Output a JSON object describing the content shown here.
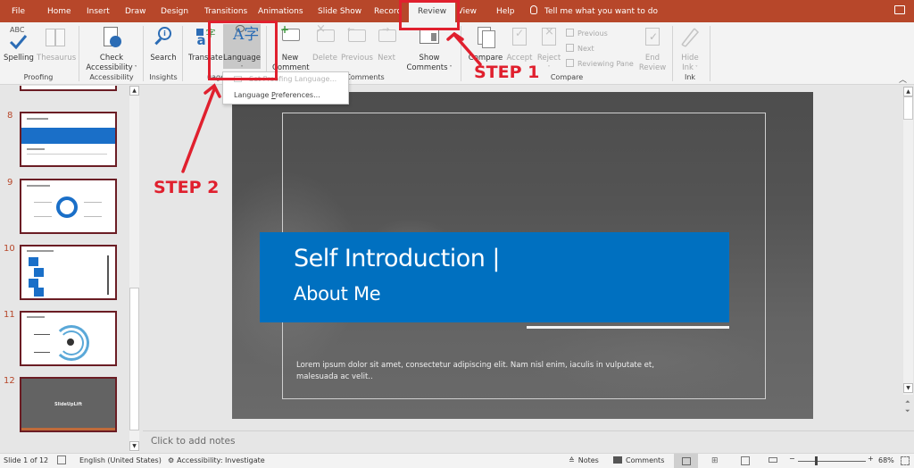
{
  "tabs": [
    {
      "label": "File"
    },
    {
      "label": "Home"
    },
    {
      "label": "Insert"
    },
    {
      "label": "Draw"
    },
    {
      "label": "Design"
    },
    {
      "label": "Transitions"
    },
    {
      "label": "Animations"
    },
    {
      "label": "Slide Show"
    },
    {
      "label": "Record"
    },
    {
      "label": "Review",
      "active": true
    },
    {
      "label": "View"
    },
    {
      "label": "Help"
    }
  ],
  "tell_me": "Tell me what you want to do",
  "ribbon": {
    "proofing": {
      "label": "Proofing",
      "spelling": "Spelling",
      "thesaurus": "Thesaurus",
      "spelling_icon_text": "ABC"
    },
    "accessibility": {
      "label": "Accessibility",
      "check_line1": "Check",
      "check_line2": "Accessibility"
    },
    "insights": {
      "label": "Insights",
      "search": "Search"
    },
    "language": {
      "label": "Language",
      "translate": "Translate",
      "language": "Language",
      "icon_glyph": "A字"
    },
    "comments": {
      "label": "Comments",
      "new_line1": "New",
      "new_line2": "Comment",
      "delete": "Delete",
      "previous": "Previous",
      "next": "Next",
      "show_line1": "Show",
      "show_line2": "Comments"
    },
    "compare": {
      "label": "Compare",
      "compare": "Compare",
      "accept": "Accept",
      "reject": "Reject",
      "previous": "Previous",
      "next": "Next",
      "reviewing_pane": "Reviewing Pane",
      "end_line1": "End",
      "end_line2": "Review"
    },
    "ink": {
      "label": "Ink",
      "hide_line1": "Hide",
      "hide_line2": "Ink"
    }
  },
  "language_menu": {
    "items": [
      {
        "label": "Set Proofing Language...",
        "disabled": true
      },
      {
        "label_pre": "Language ",
        "label_accel": "P",
        "label_post": "references...",
        "disabled": false
      }
    ]
  },
  "thumbnails": [
    {
      "number": "8"
    },
    {
      "number": "9"
    },
    {
      "number": "10"
    },
    {
      "number": "11"
    },
    {
      "number": "12",
      "text": "SlideUpLift"
    }
  ],
  "slide": {
    "title_line1": "Self Introduction |",
    "title_line2": "About Me",
    "body": "Lorem ipsum dolor sit amet, consectetur adipiscing elit. Nam nisl enim, iaculis in vulputate et, malesuada ac velit..",
    "accent_color": "#0070c0"
  },
  "notes_placeholder": "Click to add notes",
  "status": {
    "slide_of": "Slide 1 of 12",
    "language": "English (United States)",
    "accessibility": "Accessibility: Investigate",
    "notes": "Notes",
    "comments": "Comments",
    "zoom_level": "68%",
    "zoom_minus": "−",
    "zoom_plus": "+"
  },
  "annotations": {
    "step1": "STEP 1",
    "step2": "STEP 2",
    "color": "#e0202e"
  },
  "colors": {
    "tabbar": "#b7472a",
    "ribbon": "#f3f3f3",
    "thumb_border": "#6b1d24"
  }
}
